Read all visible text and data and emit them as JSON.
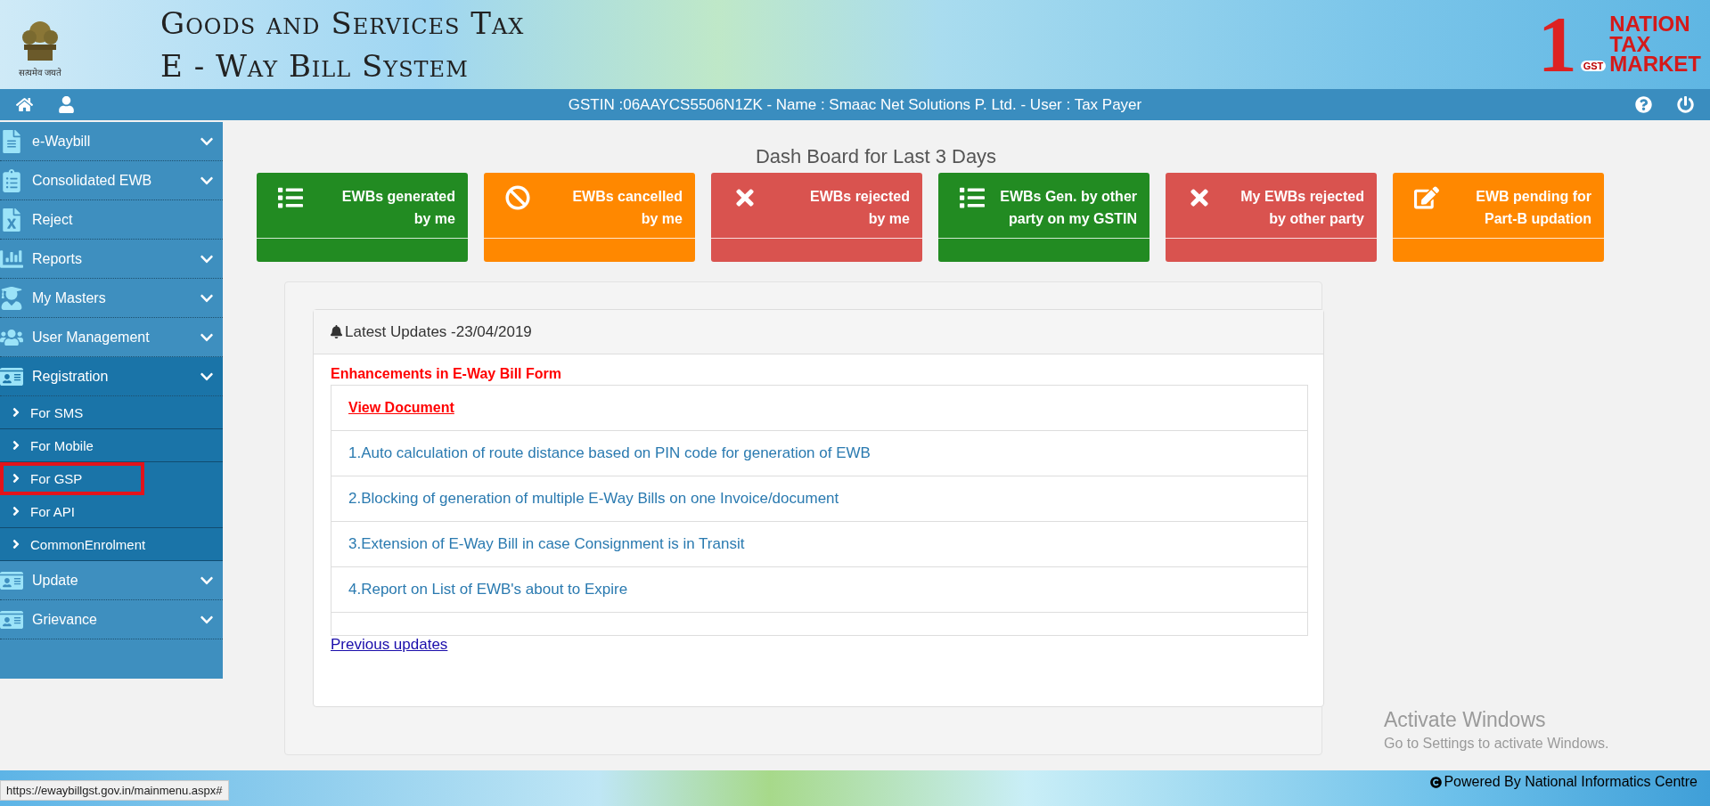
{
  "header": {
    "title_lines": [
      "Goods and Services Tax",
      "E - Way Bill System"
    ],
    "emblem_motto": "सत्यमेव जयते",
    "logo": {
      "number": "1",
      "badge": "GST",
      "words": [
        "NATION",
        "TAX",
        "MARKET"
      ]
    }
  },
  "navbar": {
    "user_info": "GSTIN :06AAYCS5506N1ZK - Name : Smaac Net Solutions P. Ltd. - User : Tax Payer"
  },
  "sidebar": {
    "items": [
      {
        "label": "e-Waybill",
        "expandable": true,
        "expanded": false
      },
      {
        "label": "Consolidated EWB",
        "expandable": true,
        "expanded": false
      },
      {
        "label": "Reject",
        "expandable": false,
        "expanded": false
      },
      {
        "label": "Reports",
        "expandable": true,
        "expanded": false
      },
      {
        "label": "My Masters",
        "expandable": true,
        "expanded": false
      },
      {
        "label": "User Management",
        "expandable": true,
        "expanded": false
      },
      {
        "label": "Registration",
        "expandable": true,
        "expanded": true,
        "children": [
          {
            "label": "For SMS",
            "highlighted": false
          },
          {
            "label": "For Mobile",
            "highlighted": false
          },
          {
            "label": "For GSP",
            "highlighted": true
          },
          {
            "label": "For API",
            "highlighted": false
          },
          {
            "label": "CommonEnrolment",
            "highlighted": false
          }
        ]
      },
      {
        "label": "Update",
        "expandable": true,
        "expanded": false
      },
      {
        "label": "Grievance",
        "expandable": true,
        "expanded": false
      }
    ]
  },
  "dashboard": {
    "title": "Dash Board for Last 3 Days",
    "cards": [
      {
        "lines": [
          "EWBs generated",
          "by me"
        ],
        "color": "#228b22"
      },
      {
        "lines": [
          "EWBs cancelled",
          "by me"
        ],
        "color": "#ff8800"
      },
      {
        "lines": [
          "EWBs rejected",
          "by me"
        ],
        "color": "#d9534f"
      },
      {
        "lines": [
          "EWBs Gen. by other",
          "party on my GSTIN"
        ],
        "color": "#228b22"
      },
      {
        "lines": [
          "My EWBs rejected",
          "by other party"
        ],
        "color": "#d9534f"
      },
      {
        "lines": [
          "EWB pending for",
          "Part-B updation"
        ],
        "color": "#ff8800"
      }
    ]
  },
  "updates": {
    "heading": "Latest Updates -23/04/2019",
    "subject": "Enhancements in E-Way Bill Form",
    "document_link": "View Document",
    "items": [
      "1.Auto calculation of route distance based on PIN code for generation of EWB",
      "2.Blocking of generation of multiple E-Way Bills on one Invoice/document",
      "3.Extension of E-Way Bill in case Consignment is in Transit",
      "4.Report on List of EWB's about to Expire"
    ],
    "previous_link": "Previous updates"
  },
  "footer": {
    "powered_by": "Powered By National Informatics Centre"
  },
  "browser_status_url": "https://ewaybillgst.gov.in/mainmenu.aspx#",
  "os_notice": {
    "title": "Activate Windows",
    "text": "Go to Settings to activate Windows."
  }
}
